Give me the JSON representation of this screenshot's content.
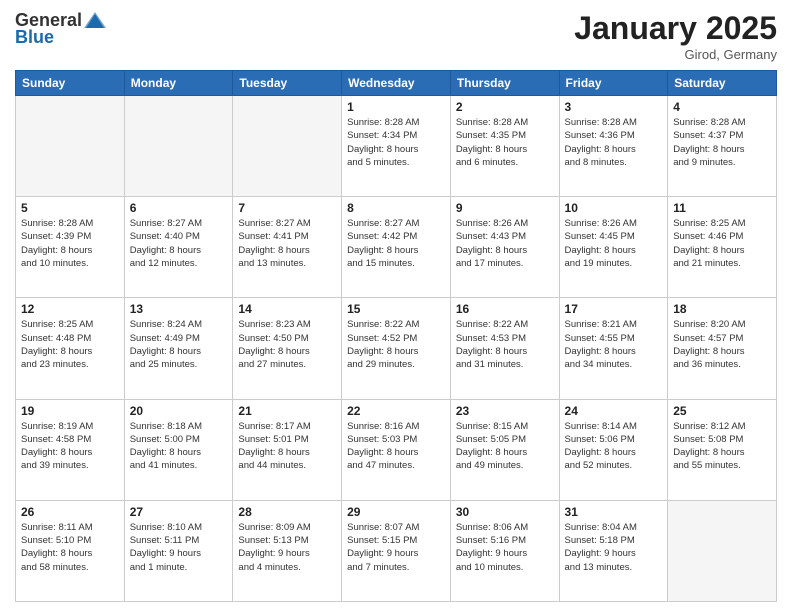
{
  "header": {
    "logo_general": "General",
    "logo_blue": "Blue",
    "month": "January 2025",
    "location": "Girod, Germany"
  },
  "weekdays": [
    "Sunday",
    "Monday",
    "Tuesday",
    "Wednesday",
    "Thursday",
    "Friday",
    "Saturday"
  ],
  "weeks": [
    [
      {
        "day": "",
        "info": "",
        "empty": true
      },
      {
        "day": "",
        "info": "",
        "empty": true
      },
      {
        "day": "",
        "info": "",
        "empty": true
      },
      {
        "day": "1",
        "info": "Sunrise: 8:28 AM\nSunset: 4:34 PM\nDaylight: 8 hours\nand 5 minutes.",
        "empty": false
      },
      {
        "day": "2",
        "info": "Sunrise: 8:28 AM\nSunset: 4:35 PM\nDaylight: 8 hours\nand 6 minutes.",
        "empty": false
      },
      {
        "day": "3",
        "info": "Sunrise: 8:28 AM\nSunset: 4:36 PM\nDaylight: 8 hours\nand 8 minutes.",
        "empty": false
      },
      {
        "day": "4",
        "info": "Sunrise: 8:28 AM\nSunset: 4:37 PM\nDaylight: 8 hours\nand 9 minutes.",
        "empty": false
      }
    ],
    [
      {
        "day": "5",
        "info": "Sunrise: 8:28 AM\nSunset: 4:39 PM\nDaylight: 8 hours\nand 10 minutes.",
        "empty": false
      },
      {
        "day": "6",
        "info": "Sunrise: 8:27 AM\nSunset: 4:40 PM\nDaylight: 8 hours\nand 12 minutes.",
        "empty": false
      },
      {
        "day": "7",
        "info": "Sunrise: 8:27 AM\nSunset: 4:41 PM\nDaylight: 8 hours\nand 13 minutes.",
        "empty": false
      },
      {
        "day": "8",
        "info": "Sunrise: 8:27 AM\nSunset: 4:42 PM\nDaylight: 8 hours\nand 15 minutes.",
        "empty": false
      },
      {
        "day": "9",
        "info": "Sunrise: 8:26 AM\nSunset: 4:43 PM\nDaylight: 8 hours\nand 17 minutes.",
        "empty": false
      },
      {
        "day": "10",
        "info": "Sunrise: 8:26 AM\nSunset: 4:45 PM\nDaylight: 8 hours\nand 19 minutes.",
        "empty": false
      },
      {
        "day": "11",
        "info": "Sunrise: 8:25 AM\nSunset: 4:46 PM\nDaylight: 8 hours\nand 21 minutes.",
        "empty": false
      }
    ],
    [
      {
        "day": "12",
        "info": "Sunrise: 8:25 AM\nSunset: 4:48 PM\nDaylight: 8 hours\nand 23 minutes.",
        "empty": false
      },
      {
        "day": "13",
        "info": "Sunrise: 8:24 AM\nSunset: 4:49 PM\nDaylight: 8 hours\nand 25 minutes.",
        "empty": false
      },
      {
        "day": "14",
        "info": "Sunrise: 8:23 AM\nSunset: 4:50 PM\nDaylight: 8 hours\nand 27 minutes.",
        "empty": false
      },
      {
        "day": "15",
        "info": "Sunrise: 8:22 AM\nSunset: 4:52 PM\nDaylight: 8 hours\nand 29 minutes.",
        "empty": false
      },
      {
        "day": "16",
        "info": "Sunrise: 8:22 AM\nSunset: 4:53 PM\nDaylight: 8 hours\nand 31 minutes.",
        "empty": false
      },
      {
        "day": "17",
        "info": "Sunrise: 8:21 AM\nSunset: 4:55 PM\nDaylight: 8 hours\nand 34 minutes.",
        "empty": false
      },
      {
        "day": "18",
        "info": "Sunrise: 8:20 AM\nSunset: 4:57 PM\nDaylight: 8 hours\nand 36 minutes.",
        "empty": false
      }
    ],
    [
      {
        "day": "19",
        "info": "Sunrise: 8:19 AM\nSunset: 4:58 PM\nDaylight: 8 hours\nand 39 minutes.",
        "empty": false
      },
      {
        "day": "20",
        "info": "Sunrise: 8:18 AM\nSunset: 5:00 PM\nDaylight: 8 hours\nand 41 minutes.",
        "empty": false
      },
      {
        "day": "21",
        "info": "Sunrise: 8:17 AM\nSunset: 5:01 PM\nDaylight: 8 hours\nand 44 minutes.",
        "empty": false
      },
      {
        "day": "22",
        "info": "Sunrise: 8:16 AM\nSunset: 5:03 PM\nDaylight: 8 hours\nand 47 minutes.",
        "empty": false
      },
      {
        "day": "23",
        "info": "Sunrise: 8:15 AM\nSunset: 5:05 PM\nDaylight: 8 hours\nand 49 minutes.",
        "empty": false
      },
      {
        "day": "24",
        "info": "Sunrise: 8:14 AM\nSunset: 5:06 PM\nDaylight: 8 hours\nand 52 minutes.",
        "empty": false
      },
      {
        "day": "25",
        "info": "Sunrise: 8:12 AM\nSunset: 5:08 PM\nDaylight: 8 hours\nand 55 minutes.",
        "empty": false
      }
    ],
    [
      {
        "day": "26",
        "info": "Sunrise: 8:11 AM\nSunset: 5:10 PM\nDaylight: 8 hours\nand 58 minutes.",
        "empty": false
      },
      {
        "day": "27",
        "info": "Sunrise: 8:10 AM\nSunset: 5:11 PM\nDaylight: 9 hours\nand 1 minute.",
        "empty": false
      },
      {
        "day": "28",
        "info": "Sunrise: 8:09 AM\nSunset: 5:13 PM\nDaylight: 9 hours\nand 4 minutes.",
        "empty": false
      },
      {
        "day": "29",
        "info": "Sunrise: 8:07 AM\nSunset: 5:15 PM\nDaylight: 9 hours\nand 7 minutes.",
        "empty": false
      },
      {
        "day": "30",
        "info": "Sunrise: 8:06 AM\nSunset: 5:16 PM\nDaylight: 9 hours\nand 10 minutes.",
        "empty": false
      },
      {
        "day": "31",
        "info": "Sunrise: 8:04 AM\nSunset: 5:18 PM\nDaylight: 9 hours\nand 13 minutes.",
        "empty": false
      },
      {
        "day": "",
        "info": "",
        "empty": true
      }
    ]
  ]
}
